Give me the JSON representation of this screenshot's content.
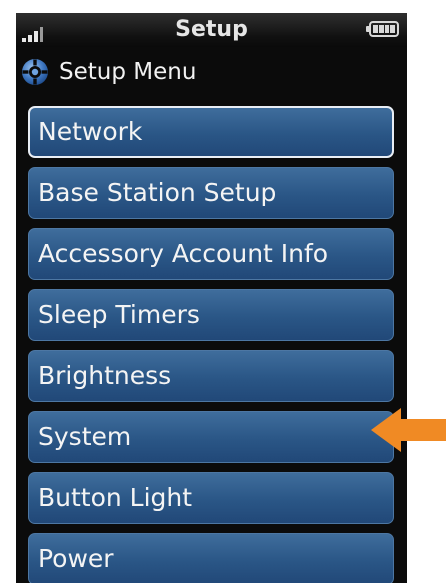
{
  "status_bar": {
    "title": "Setup"
  },
  "icons": {
    "signal": "signal-strength-icon",
    "battery": "battery-icon",
    "setup": "setup-gear-icon",
    "pointer": "arrow-left-icon"
  },
  "header": {
    "title": "Setup Menu"
  },
  "menu": {
    "items": [
      {
        "label": "Network",
        "selected": true
      },
      {
        "label": "Base Station Setup",
        "selected": false
      },
      {
        "label": "Accessory Account Info",
        "selected": false
      },
      {
        "label": "Sleep Timers",
        "selected": false
      },
      {
        "label": "Brightness",
        "selected": false
      },
      {
        "label": "System",
        "selected": false
      },
      {
        "label": "Button Light",
        "selected": false
      },
      {
        "label": "Power",
        "selected": false
      }
    ]
  },
  "colors": {
    "menu_button": "#2a5686",
    "menu_border": "#4d77a3",
    "selected_border": "#e9eef5",
    "pointer_arrow": "#f08a24",
    "background": "#0b0b0b"
  }
}
